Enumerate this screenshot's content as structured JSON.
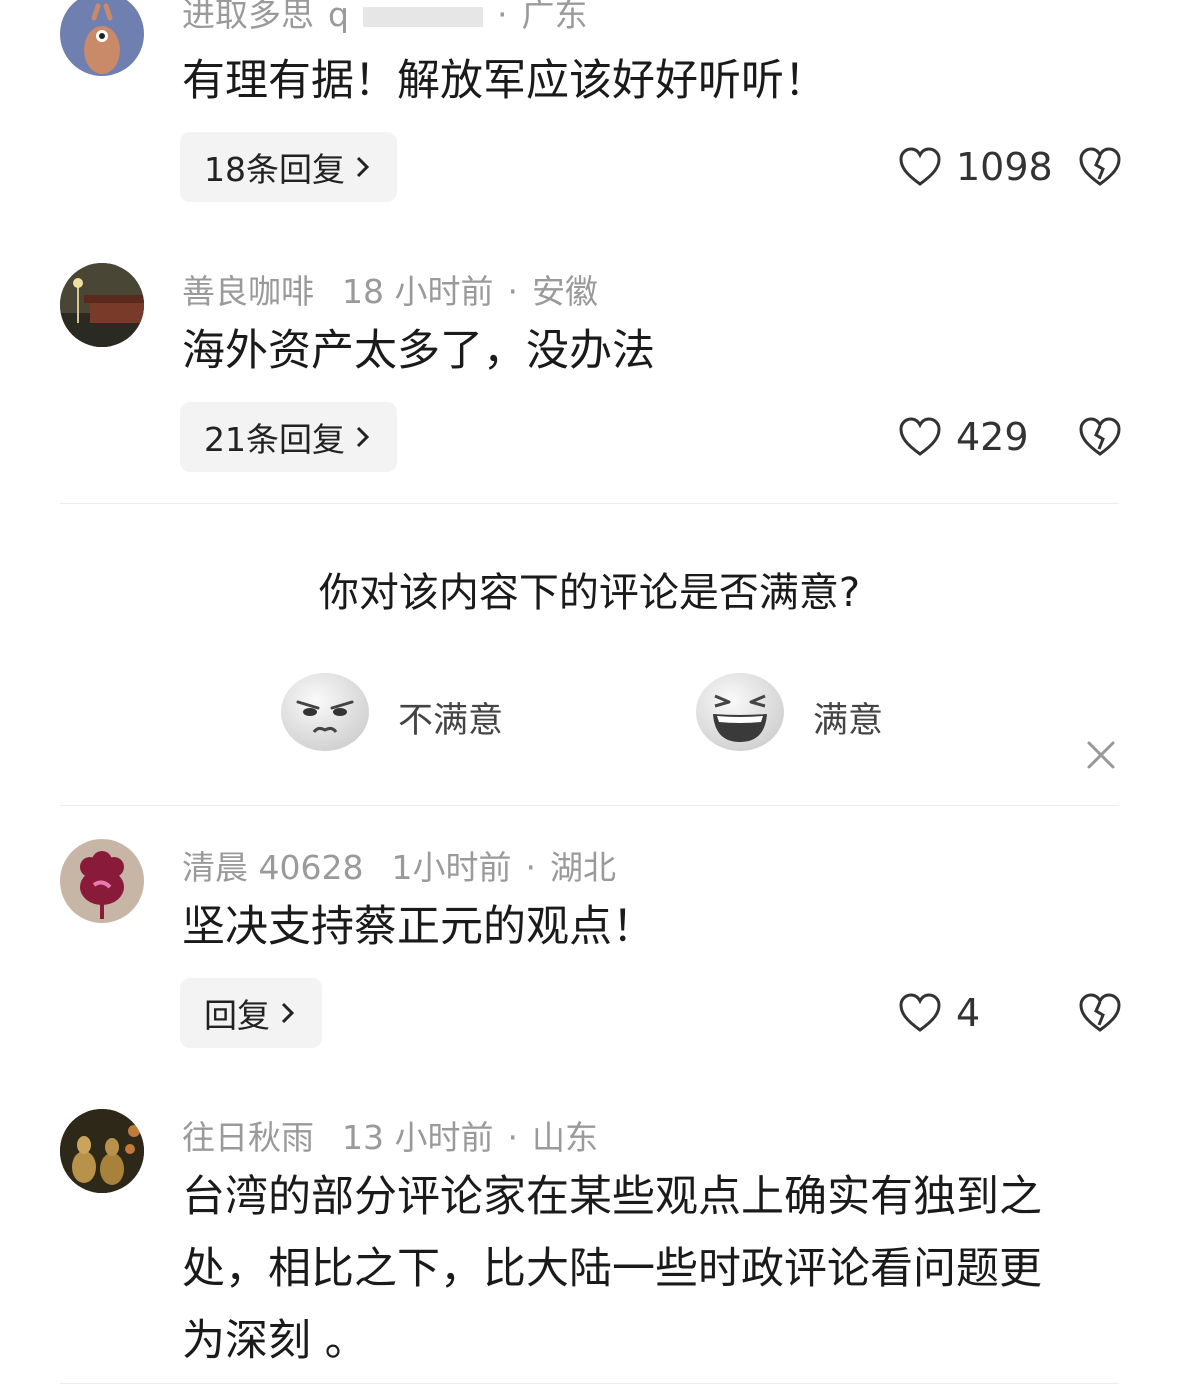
{
  "comments": [
    {
      "username": "进取多思",
      "time": "",
      "location": "广东",
      "text": "有理有据！解放军应该好好听听！",
      "reply_label": "18条回复",
      "likes": "1098"
    },
    {
      "username": "善良咖啡",
      "time": "18 小时前",
      "location": "安徽",
      "text": "海外资产太多了，没办法",
      "reply_label": "21条回复",
      "likes": "429"
    },
    {
      "username": "清晨 40628",
      "time": "1小时前",
      "location": "湖北",
      "text": "坚决支持蔡正元的观点！",
      "reply_label": "回复",
      "likes": "4"
    },
    {
      "username": "往日秋雨",
      "time": "13 小时前",
      "location": "山东",
      "text_lines": [
        "台湾的部分评论家在某些观点上确实有独到之",
        "处，相比之下，比大陆一些时政评论看问题更",
        "为深刻 。"
      ]
    }
  ],
  "survey": {
    "question": "你对该内容下的评论是否满意?",
    "option_dissatisfied": "不满意",
    "option_satisfied": "满意"
  },
  "icons": {
    "like": "heart-outline-icon",
    "dislike": "broken-heart-icon",
    "close": "close-icon",
    "chevron": "chevron-right-icon"
  }
}
